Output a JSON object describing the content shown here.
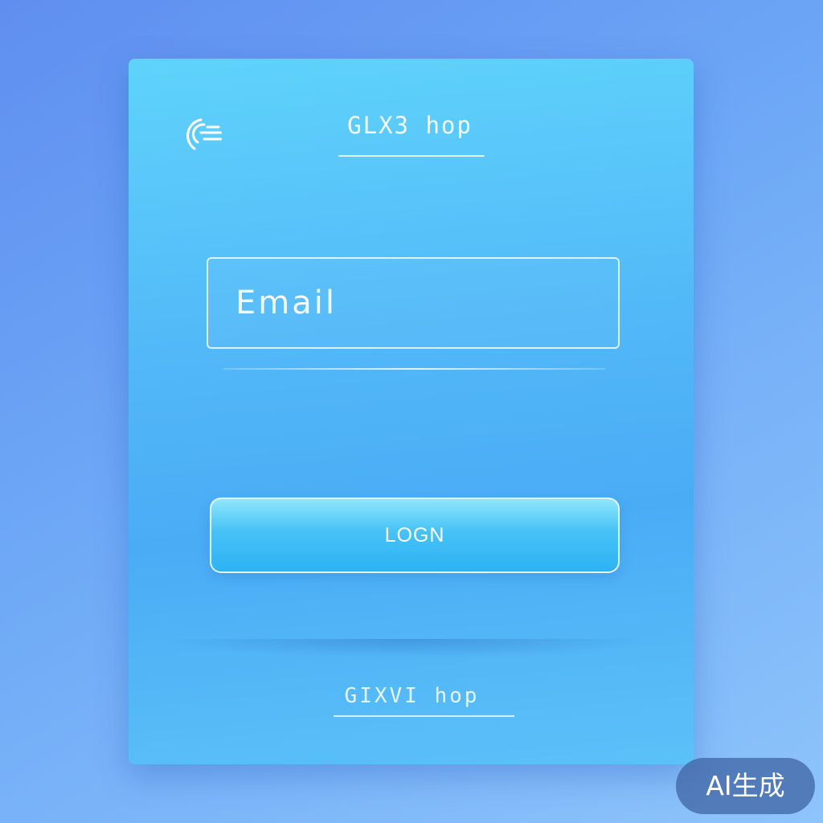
{
  "header": {
    "brand": "GLX3 hop",
    "logo_icon": "wifi-arc-logo-icon"
  },
  "form": {
    "email_placeholder": "Email",
    "login_label": "LOGN"
  },
  "footer": {
    "brand": "GIXVI hop"
  },
  "watermark": {
    "label": "AI生成"
  },
  "colors": {
    "background": "#6ea9f6",
    "card": "#52b8f8",
    "button": "#46c2f7",
    "text": "#ffffff"
  }
}
